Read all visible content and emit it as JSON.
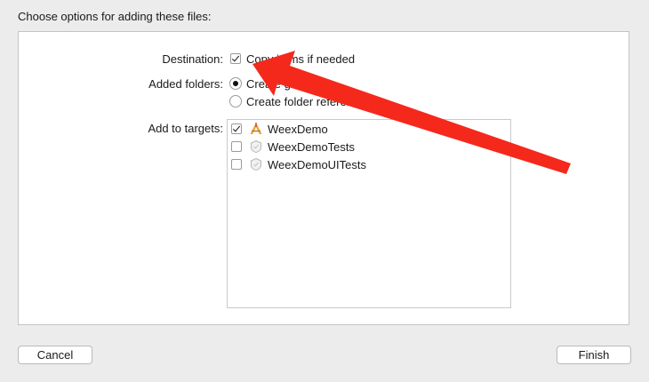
{
  "dialog": {
    "heading": "Choose options for adding these files:",
    "destination": {
      "label": "Destination:",
      "option_label": "Copy items if needed",
      "checked": true
    },
    "added_folders": {
      "label": "Added folders:",
      "options": [
        {
          "label": "Create groups",
          "selected": true
        },
        {
          "label": "Create folder references",
          "selected": false
        }
      ]
    },
    "targets": {
      "label": "Add to targets:",
      "items": [
        {
          "name": "WeexDemo",
          "checked": true,
          "icon": "app-target-icon"
        },
        {
          "name": "WeexDemoTests",
          "checked": false,
          "icon": "test-target-icon"
        },
        {
          "name": "WeexDemoUITests",
          "checked": false,
          "icon": "test-target-icon"
        }
      ]
    },
    "buttons": {
      "cancel": "Cancel",
      "finish": "Finish"
    }
  },
  "colors": {
    "background": "#ececec",
    "annotation_arrow": "#f5281c"
  }
}
